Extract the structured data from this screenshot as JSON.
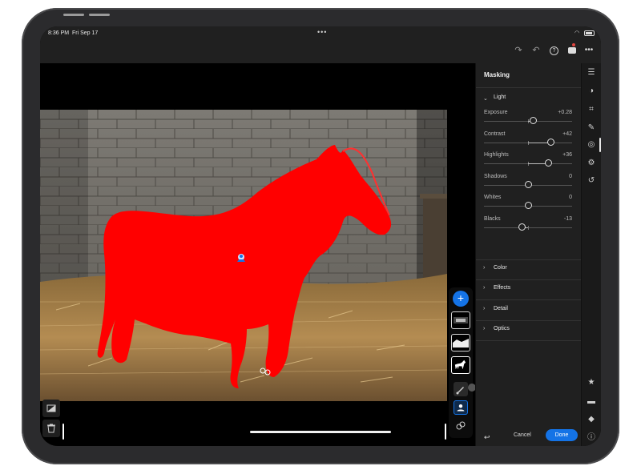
{
  "status_bar": {
    "time": "8:36 PM",
    "date": "Fri Sep 17"
  },
  "toolbar": {
    "icons": [
      "redo-icon",
      "undo-icon",
      "help-icon",
      "cloud-camera-icon",
      "more-icon"
    ],
    "help_glyph": "?",
    "more_glyph": "•••"
  },
  "panel": {
    "title": "Masking",
    "light_section": "Light",
    "sliders": [
      {
        "label": "Exposure",
        "value": "+0.28",
        "position": 0.56
      },
      {
        "label": "Contrast",
        "value": "+42",
        "position": 0.76
      },
      {
        "label": "Highlights",
        "value": "+36",
        "position": 0.73
      },
      {
        "label": "Shadows",
        "value": "0",
        "position": 0.5
      },
      {
        "label": "Whites",
        "value": "0",
        "position": 0.5
      },
      {
        "label": "Blacks",
        "value": "-13",
        "position": 0.43
      }
    ],
    "collapsed_sections": [
      "Color",
      "Effects",
      "Detail",
      "Optics"
    ],
    "cancel_label": "Cancel",
    "done_label": "Done"
  },
  "mask_panel": {
    "add_label": "+"
  },
  "colors": {
    "accent": "#1473e6",
    "mask_overlay": "#ff0000",
    "panel_bg": "#202020",
    "notification": "#e0453f"
  }
}
